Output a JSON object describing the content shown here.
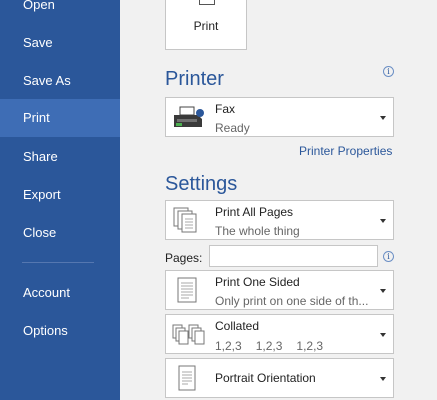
{
  "sidebar": {
    "items": [
      {
        "label": "Open",
        "selected": false
      },
      {
        "label": "Save",
        "selected": false
      },
      {
        "label": "Save As",
        "selected": false
      },
      {
        "label": "Print",
        "selected": true
      },
      {
        "label": "Share",
        "selected": false
      },
      {
        "label": "Export",
        "selected": false
      },
      {
        "label": "Close",
        "selected": false
      },
      {
        "label": "Account",
        "selected": false
      },
      {
        "label": "Options",
        "selected": false
      }
    ]
  },
  "print_button": {
    "label": "Print",
    "icon": "printer-icon"
  },
  "printer": {
    "heading": "Printer",
    "name": "Fax",
    "status": "Ready",
    "properties_link": "Printer Properties"
  },
  "settings": {
    "heading": "Settings",
    "pages_mode": {
      "title": "Print All Pages",
      "subtitle": "The whole thing"
    },
    "pages_label": "Pages:",
    "pages_value": "",
    "sides": {
      "title": "Print One Sided",
      "subtitle": "Only print on one side of th..."
    },
    "collation": {
      "title": "Collated",
      "values": [
        "1,2,3",
        "1,2,3",
        "1,2,3"
      ]
    },
    "orientation": {
      "title": "Portrait Orientation"
    }
  },
  "colors": {
    "accent": "#2b579a",
    "selected_nav": "#3e6db5",
    "background": "#f1f1f1"
  }
}
